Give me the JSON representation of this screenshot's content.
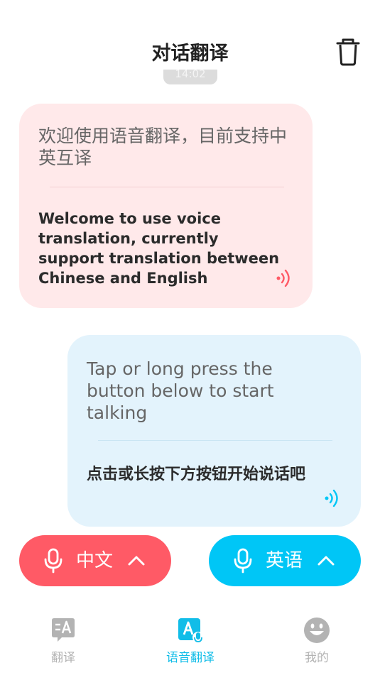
{
  "header": {
    "title": "对话翻译",
    "trash_icon": "trash-icon"
  },
  "time_pill": "14:02",
  "messages": [
    {
      "side": "left",
      "source_text": "欢迎使用语音翻译，目前支持中英互译",
      "translation": "Welcome to use voice translation, currently support translation between Chinese and English",
      "speaker_icon": "speaker-wave-icon",
      "accent": "#ff5a66"
    },
    {
      "side": "right",
      "source_text": "Tap or long press the button below to start talking",
      "translation": "点击或长按下方按钮开始说话吧",
      "speaker_icon": "speaker-wave-icon",
      "accent": "#00c6f6"
    }
  ],
  "lang_buttons": [
    {
      "label": "中文",
      "icon": "microphone-icon",
      "chevron": "chevron-up-icon",
      "color": "#ff5a66"
    },
    {
      "label": "英语",
      "icon": "microphone-icon",
      "chevron": "chevron-up-icon",
      "color": "#00c6f6"
    }
  ],
  "tabs": [
    {
      "label": "翻译",
      "icon": "translate-chat-icon",
      "active": false
    },
    {
      "label": "语音翻译",
      "icon": "voice-translate-icon",
      "active": true
    },
    {
      "label": "我的",
      "icon": "smiley-face-icon",
      "active": false
    }
  ],
  "colors": {
    "active_tab": "#11bde8",
    "inactive_tab": "#b3b3b3",
    "left_bubble_bg": "#ffe9ea",
    "right_bubble_bg": "#e3f3fc"
  }
}
